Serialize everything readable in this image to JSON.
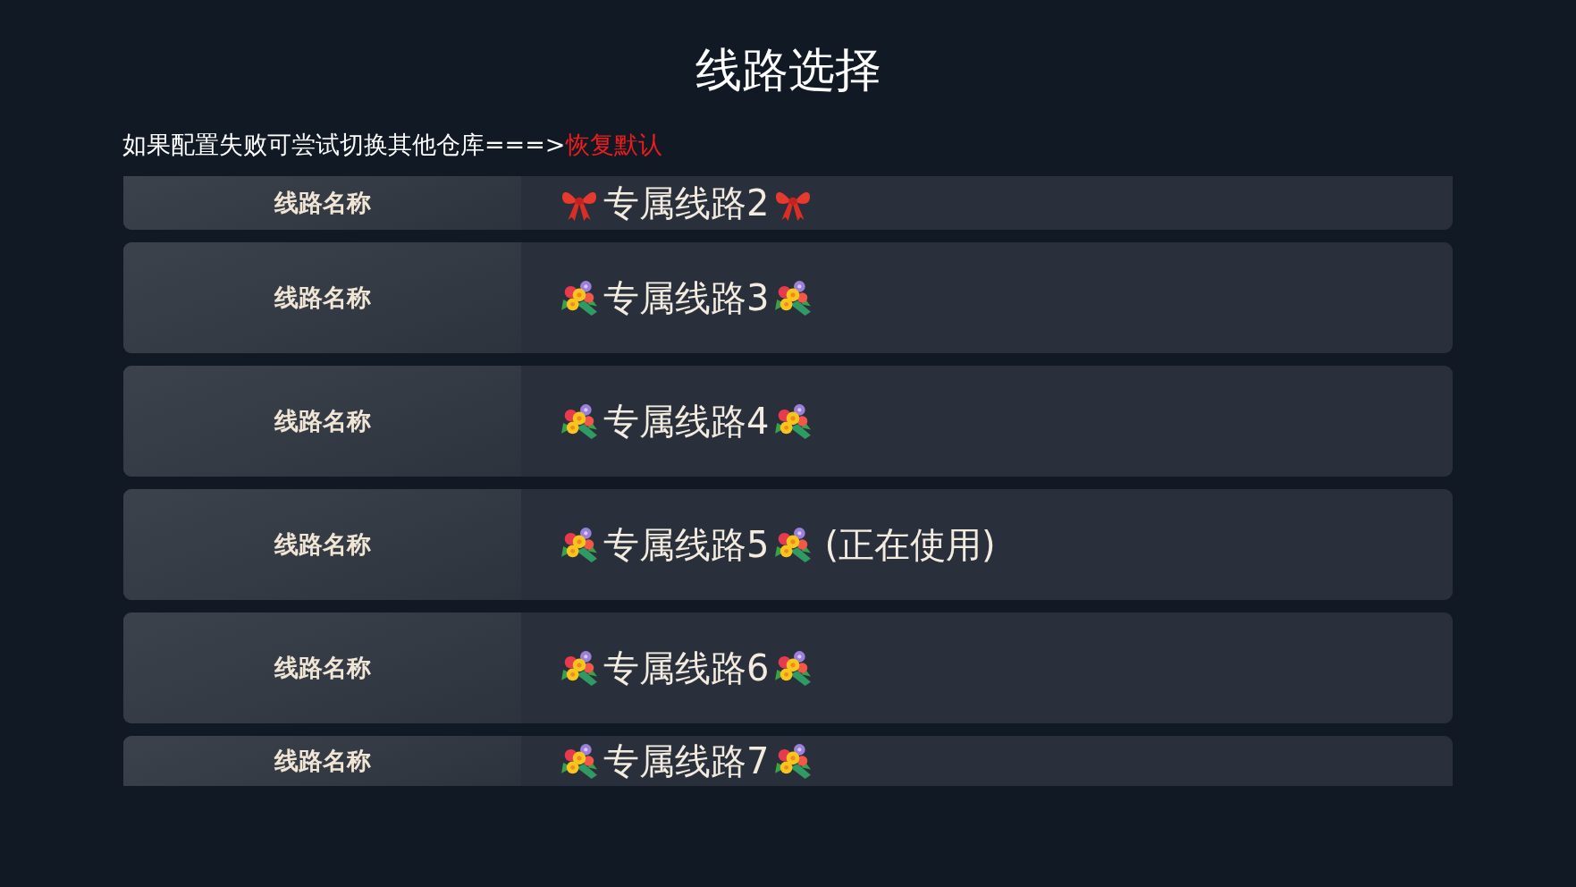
{
  "title": "线路选择",
  "hint": {
    "text": "如果配置失败可尝试切换其他仓库===>",
    "link": "恢复默认"
  },
  "routes": [
    {
      "kind": "ribbon",
      "label": "线路名称",
      "name": "专属线路2"
    },
    {
      "kind": "bouquet",
      "label": "线路名称",
      "name": "专属线路3"
    },
    {
      "kind": "bouquet",
      "label": "线路名称",
      "name": "专属线路4"
    },
    {
      "kind": "bouquet",
      "label": "线路名称",
      "name": "专属线路5",
      "note": "(正在使用)"
    },
    {
      "kind": "bouquet",
      "label": "线路名称",
      "name": "专属线路6"
    },
    {
      "kind": "bouquet",
      "label": "线路名称",
      "name": "专属线路7"
    }
  ]
}
